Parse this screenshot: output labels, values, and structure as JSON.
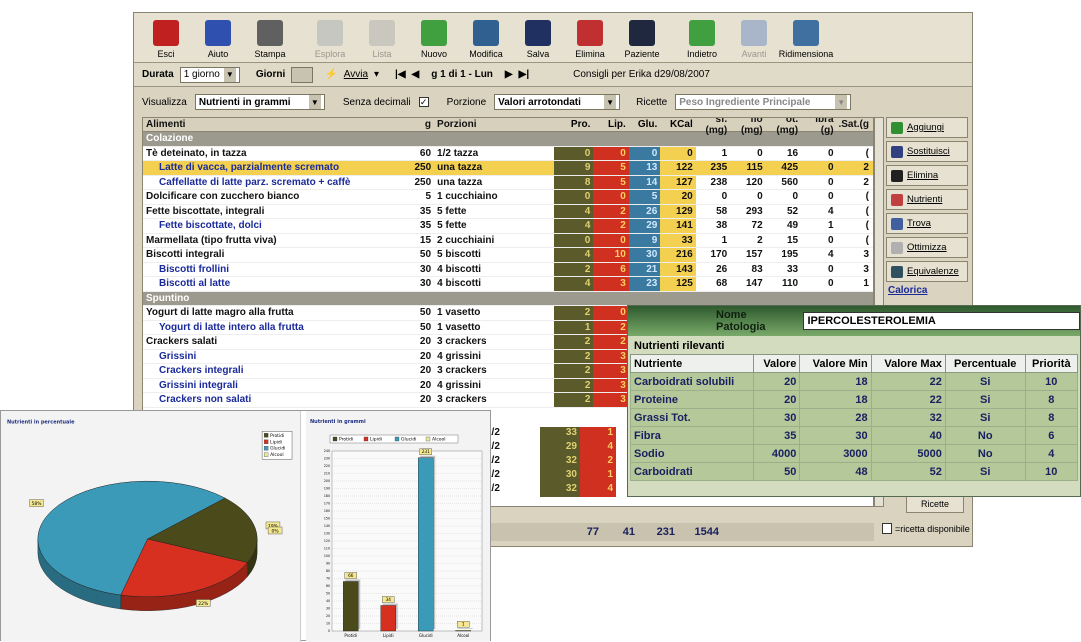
{
  "toolbar": {
    "items": [
      {
        "label": "Esci",
        "icon": "exit-icon",
        "color": "#c02020",
        "enabled": true
      },
      {
        "label": "Aiuto",
        "icon": "help-icon",
        "color": "#3050b0",
        "enabled": true
      },
      {
        "label": "Stampa",
        "icon": "printer-icon",
        "color": "#606060",
        "enabled": true
      },
      {
        "label": "Esplora",
        "icon": "explore-icon",
        "color": "#a0a8b0",
        "enabled": false
      },
      {
        "label": "Lista",
        "icon": "list-icon",
        "color": "#a8a8a8",
        "enabled": false
      },
      {
        "label": "Nuovo",
        "icon": "new-icon",
        "color": "#40a040",
        "enabled": true
      },
      {
        "label": "Modifica",
        "icon": "edit-icon",
        "color": "#306090",
        "enabled": true
      },
      {
        "label": "Salva",
        "icon": "save-icon",
        "color": "#203060",
        "enabled": true
      },
      {
        "label": "Elimina",
        "icon": "delete-icon",
        "color": "#c03030",
        "enabled": true
      },
      {
        "label": "Paziente",
        "icon": "patient-icon",
        "color": "#202840",
        "enabled": true
      },
      {
        "label": "Indietro",
        "icon": "back-arrow-icon",
        "color": "#40a040",
        "enabled": true
      },
      {
        "label": "Avanti",
        "icon": "forward-arrow-icon",
        "color": "#6080c0",
        "enabled": false
      },
      {
        "label": "Ridimensiona",
        "icon": "resize-icon",
        "color": "#4070a0",
        "enabled": true
      }
    ]
  },
  "navbar": {
    "durata_label": "Durata",
    "durata_value": "1 giorno",
    "giorni_label": "Giorni",
    "avvia_label": "Avvia",
    "day_label": "g 1 di 1 - Lun",
    "consigli": "Consigli per Erika d29/08/2007"
  },
  "filters": {
    "visualizza_label": "Visualizza",
    "visualizza_value": "Nutrienti in grammi",
    "senza_decimali_label": "Senza decimali",
    "porzione_label": "Porzione",
    "porzione_value": "Valori arrotondati",
    "ricette_label": "Ricette",
    "ricette_value": "Peso Ingrediente Principale"
  },
  "table": {
    "headers": {
      "name": "Alimenti",
      "g": "g",
      "por": "Porzioni",
      "pro": "Pro.",
      "lip": "Lip.",
      "glu": "Glu.",
      "kcal": "KCal",
      "c1": "sf. (mg)",
      "c2": "fio (mg)",
      "c3": "ot. (mg)",
      "c4": "ibra (g)",
      "c5": ".Sat.(g"
    },
    "rows": [
      {
        "type": "section",
        "name": "Colazione"
      },
      {
        "type": "main",
        "name": "Tè deteinato, in tazza",
        "g": "60",
        "por": "1/2 tazza",
        "pro": "0",
        "lip": "0",
        "glu": "0",
        "kcal": "0",
        "c1": "1",
        "c2": "0",
        "c3": "16",
        "c4": "0",
        "c5": "("
      },
      {
        "type": "selected",
        "name": "Latte di vacca, parzialmente scremato",
        "g": "250",
        "por": "una tazza",
        "pro": "9",
        "lip": "5",
        "glu": "13",
        "kcal": "122",
        "c1": "235",
        "c2": "115",
        "c3": "425",
        "c4": "0",
        "c5": "2"
      },
      {
        "type": "sub",
        "name": "Caffellatte di latte parz. scremato + caffè",
        "g": "250",
        "por": "una tazza",
        "pro": "8",
        "lip": "5",
        "glu": "14",
        "kcal": "127",
        "c1": "238",
        "c2": "120",
        "c3": "560",
        "c4": "0",
        "c5": "2"
      },
      {
        "type": "main",
        "name": "Dolcificare con zucchero bianco",
        "g": "5",
        "por": "1 cucchiaino",
        "pro": "0",
        "lip": "0",
        "glu": "5",
        "kcal": "20",
        "c1": "0",
        "c2": "0",
        "c3": "0",
        "c4": "0",
        "c5": "("
      },
      {
        "type": "main",
        "name": "Fette biscottate, integrali",
        "g": "35",
        "por": "5 fette",
        "pro": "4",
        "lip": "2",
        "glu": "26",
        "kcal": "129",
        "c1": "58",
        "c2": "293",
        "c3": "52",
        "c4": "4",
        "c5": "("
      },
      {
        "type": "sub",
        "name": "Fette biscottate, dolci",
        "g": "35",
        "por": "5 fette",
        "pro": "4",
        "lip": "2",
        "glu": "29",
        "kcal": "141",
        "c1": "38",
        "c2": "72",
        "c3": "49",
        "c4": "1",
        "c5": "("
      },
      {
        "type": "main",
        "name": "Marmellata (tipo frutta viva)",
        "g": "15",
        "por": "2 cucchiaini",
        "pro": "0",
        "lip": "0",
        "glu": "9",
        "kcal": "33",
        "c1": "1",
        "c2": "2",
        "c3": "15",
        "c4": "0",
        "c5": "("
      },
      {
        "type": "main",
        "name": "Biscotti integrali",
        "g": "50",
        "por": "5 biscotti",
        "pro": "4",
        "lip": "10",
        "glu": "30",
        "kcal": "216",
        "c1": "170",
        "c2": "157",
        "c3": "195",
        "c4": "4",
        "c5": "3"
      },
      {
        "type": "sub",
        "name": "Biscotti frollini",
        "g": "30",
        "por": "4 biscotti",
        "pro": "2",
        "lip": "6",
        "glu": "21",
        "kcal": "143",
        "c1": "26",
        "c2": "83",
        "c3": "33",
        "c4": "0",
        "c5": "3"
      },
      {
        "type": "sub",
        "name": "Biscotti al latte",
        "g": "30",
        "por": "4 biscotti",
        "pro": "4",
        "lip": "3",
        "glu": "23",
        "kcal": "125",
        "c1": "68",
        "c2": "147",
        "c3": "110",
        "c4": "0",
        "c5": "1"
      },
      {
        "type": "section",
        "name": "Spuntino"
      },
      {
        "type": "main",
        "name": "Yogurt di latte magro alla frutta",
        "g": "50",
        "por": "1 vasetto",
        "pro": "2",
        "lip": "0",
        "glu": "",
        "kcal": "",
        "c1": "",
        "c2": "",
        "c3": "",
        "c4": "",
        "c5": ""
      },
      {
        "type": "sub",
        "name": "Yogurt di latte intero alla frutta",
        "g": "50",
        "por": "1 vasetto",
        "pro": "1",
        "lip": "2",
        "glu": "",
        "kcal": "",
        "c1": "",
        "c2": "",
        "c3": "",
        "c4": "",
        "c5": ""
      },
      {
        "type": "main",
        "name": "Crackers salati",
        "g": "20",
        "por": "3 crackers",
        "pro": "2",
        "lip": "2",
        "glu": "",
        "kcal": "",
        "c1": "",
        "c2": "",
        "c3": "",
        "c4": "",
        "c5": ""
      },
      {
        "type": "sub",
        "name": "Grissini",
        "g": "20",
        "por": "4 grissini",
        "pro": "2",
        "lip": "3",
        "glu": "",
        "kcal": "",
        "c1": "",
        "c2": "",
        "c3": "",
        "c4": "",
        "c5": ""
      },
      {
        "type": "sub",
        "name": "Crackers integrali",
        "g": "20",
        "por": "3 crackers",
        "pro": "2",
        "lip": "3",
        "glu": "",
        "kcal": "",
        "c1": "",
        "c2": "",
        "c3": "",
        "c4": "",
        "c5": ""
      },
      {
        "type": "sub",
        "name": "Grissini integrali",
        "g": "20",
        "por": "4 grissini",
        "pro": "2",
        "lip": "3",
        "glu": "",
        "kcal": "",
        "c1": "",
        "c2": "",
        "c3": "",
        "c4": "",
        "c5": ""
      },
      {
        "type": "sub",
        "name": "Crackers non salati",
        "g": "20",
        "por": "3 crackers",
        "pro": "2",
        "lip": "3",
        "glu": "",
        "kcal": "",
        "c1": "",
        "c2": "",
        "c3": "",
        "c4": "",
        "c5": ""
      }
    ],
    "partial_rows": [
      {
        "por": "1/2",
        "pro": "33",
        "lip": "1"
      },
      {
        "por": "1/2",
        "pro": "29",
        "lip": "4"
      },
      {
        "por": "1/2",
        "pro": "32",
        "lip": "2"
      },
      {
        "por": "1/2",
        "pro": "30",
        "lip": "1"
      },
      {
        "por": "1/2",
        "pro": "32",
        "lip": "4"
      }
    ],
    "totals": {
      "pro": "77",
      "lip": "41",
      "glu": "231",
      "kcal": "1544"
    }
  },
  "right_buttons": [
    {
      "label": "Aggiungi",
      "icon": "plus-icon",
      "color": "#309030"
    },
    {
      "label": "Sostituisci",
      "icon": "replace-icon",
      "color": "#304080"
    },
    {
      "label": "Elimina",
      "icon": "x-icon",
      "color": "#202020"
    },
    {
      "label": "Nutrienti",
      "icon": "nutrients-icon",
      "color": "#c04040"
    },
    {
      "label": "Trova",
      "icon": "find-icon",
      "color": "#4060a0"
    },
    {
      "label": "Ottimizza",
      "icon": "optimize-icon",
      "color": "#b0b0b0"
    },
    {
      "label": "Equivalenze",
      "icon": "equivalence-icon",
      "color": "#305060"
    }
  ],
  "calorica_label": "Calorica",
  "ricette_button": "Ricette",
  "ricetta_note": "=ricetta disponibile",
  "patologia": {
    "label": "Nome Patologia",
    "value": "IPERCOLESTEROLEMIA",
    "section": "Nutrienti rilevanti",
    "headers": [
      "Nutriente",
      "Valore",
      "Valore Min",
      "Valore Max",
      "Percentuale",
      "Priorità"
    ],
    "rows": [
      [
        "Carboidrati solubili",
        "20",
        "18",
        "22",
        "Si",
        "10"
      ],
      [
        "Proteine",
        "20",
        "18",
        "22",
        "Si",
        "8"
      ],
      [
        "Grassi Tot.",
        "30",
        "28",
        "32",
        "Si",
        "8"
      ],
      [
        "Fibra",
        "35",
        "30",
        "40",
        "No",
        "6"
      ],
      [
        "Sodio",
        "4000",
        "3000",
        "5000",
        "No",
        "4"
      ],
      [
        "Carboidrati",
        "50",
        "48",
        "52",
        "Si",
        "10"
      ]
    ]
  },
  "chart_data": [
    {
      "type": "pie",
      "title": "Nutrienti in percentuale",
      "legend": [
        "Protidi",
        "Lipidi",
        "Glucidi",
        "Alcool"
      ],
      "values": [
        19,
        22,
        58,
        0
      ],
      "colors": [
        "#4a4a1a",
        "#d83020",
        "#3a9ab8",
        "#e8e8a0"
      ],
      "labels": [
        "19%",
        "22%",
        "58%",
        "0%"
      ]
    },
    {
      "type": "bar",
      "title": "Nutrienti in grammi",
      "legend": [
        "Protidi",
        "Lipidi",
        "Glucidi",
        "Alcool"
      ],
      "categories": [
        "Protidi",
        "Lipidi",
        "Glucidi",
        "Alcool"
      ],
      "values": [
        66,
        34,
        231,
        1
      ],
      "colors": [
        "#4a4a1a",
        "#d83020",
        "#3a9ab8",
        "#e8e8a0"
      ],
      "ylim": [
        0,
        240
      ],
      "ytick_step": 10
    }
  ]
}
